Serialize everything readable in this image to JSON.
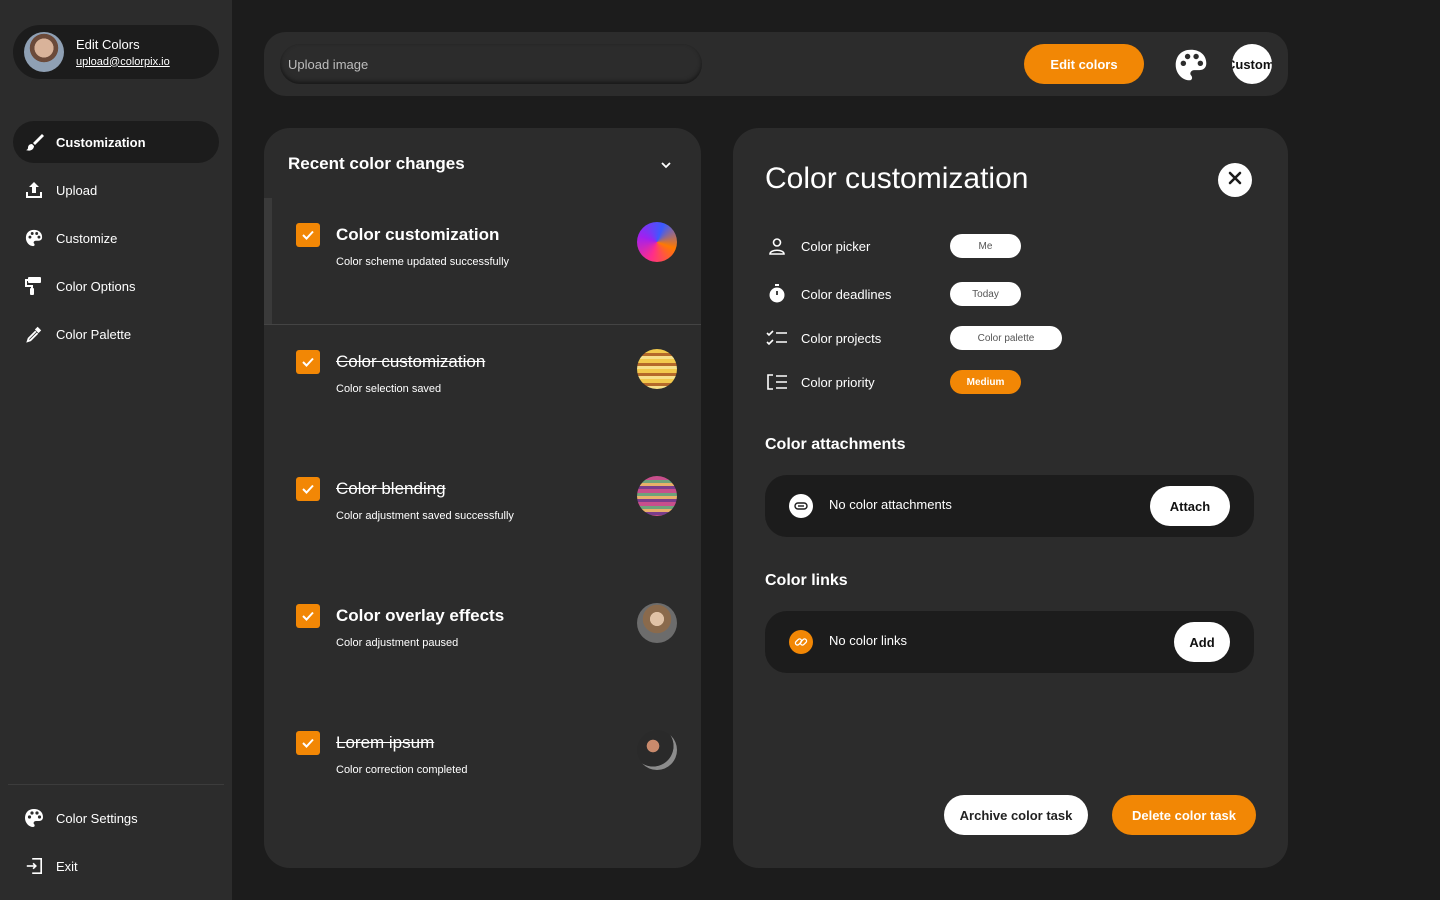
{
  "profile": {
    "name": "Edit Colors",
    "email": "upload@colorpix.io"
  },
  "sidebar": {
    "items": [
      {
        "label": "Customization",
        "icon": "brush-icon",
        "active": true
      },
      {
        "label": "Upload",
        "icon": "upload-icon"
      },
      {
        "label": "Customize",
        "icon": "palette-icon"
      },
      {
        "label": "Color Options",
        "icon": "paint-roller-icon"
      },
      {
        "label": "Color Palette",
        "icon": "eyedropper-icon"
      }
    ],
    "bottom": [
      {
        "label": "Color Settings",
        "icon": "palette-icon"
      },
      {
        "label": "Exit",
        "icon": "exit-icon"
      }
    ]
  },
  "topbar": {
    "upload_placeholder": "Upload image",
    "edit_button": "Edit colors",
    "avatar_text": "Customi"
  },
  "recent": {
    "title": "Recent color changes",
    "items": [
      {
        "title": "Color customization",
        "subtitle": "Color scheme updated successfully",
        "checked": true,
        "strike": false
      },
      {
        "title": "Color customization",
        "subtitle": "Color selection saved",
        "checked": true,
        "strike": true
      },
      {
        "title": "Color blending",
        "subtitle": "Color adjustment saved successfully",
        "checked": true,
        "strike": true
      },
      {
        "title": "Color overlay effects",
        "subtitle": "Color adjustment paused",
        "checked": true,
        "strike": false
      },
      {
        "title": "Lorem ipsum",
        "subtitle": "Color correction completed",
        "checked": true,
        "strike": true
      }
    ]
  },
  "detail": {
    "title": "Color customization",
    "properties": [
      {
        "label": "Color picker",
        "value": "Me",
        "icon": "person-icon"
      },
      {
        "label": "Color deadlines",
        "value": "Today",
        "icon": "stopwatch-icon"
      },
      {
        "label": "Color projects",
        "value": "Color palette",
        "icon": "checklist-icon"
      },
      {
        "label": "Color priority",
        "value": "Medium",
        "icon": "priority-list-icon"
      }
    ],
    "attachments": {
      "title": "Color attachments",
      "empty_text": "No color attachments",
      "button": "Attach"
    },
    "links": {
      "title": "Color links",
      "empty_text": "No color links",
      "button": "Add"
    },
    "archive_button": "Archive color task",
    "delete_button": "Delete color task"
  },
  "colors": {
    "accent": "#f28705",
    "background": "#1c1c1c",
    "panel": "#2c2c2c"
  }
}
